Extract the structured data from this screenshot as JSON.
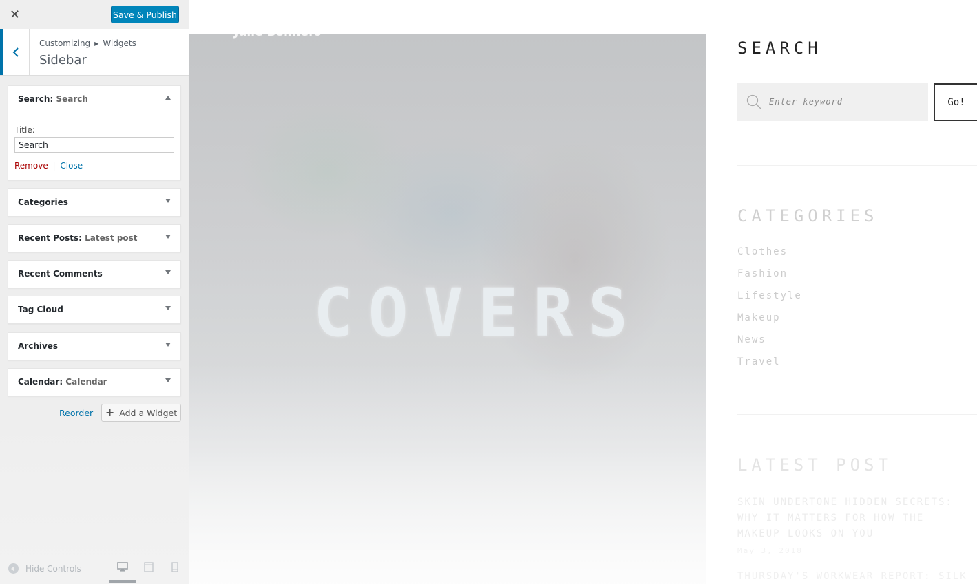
{
  "topbar": {
    "close_icon": "close-icon",
    "save_label": "Save & Publish"
  },
  "section": {
    "breadcrumb_parent": "Customizing",
    "breadcrumb_child": "Widgets",
    "title": "Sidebar"
  },
  "widgets": [
    {
      "type": "Search",
      "instance": "Search",
      "expanded": true
    },
    {
      "type": "Categories",
      "instance": ""
    },
    {
      "type": "Recent Posts",
      "instance": "Latest post"
    },
    {
      "type": "Recent Comments",
      "instance": ""
    },
    {
      "type": "Tag Cloud",
      "instance": ""
    },
    {
      "type": "Archives",
      "instance": ""
    },
    {
      "type": "Calendar",
      "instance": "Calendar"
    }
  ],
  "search_widget": {
    "title_label": "Title:",
    "title_value": "Search",
    "remove_label": "Remove",
    "separator": "|",
    "close_label": "Close"
  },
  "panel_actions": {
    "reorder_label": "Reorder",
    "add_widget_label": "Add a Widget"
  },
  "footer": {
    "hide_controls_label": "Hide Controls",
    "devices": [
      "desktop-icon",
      "tablet-icon",
      "mobile-icon"
    ],
    "active_device": "desktop"
  },
  "preview": {
    "hero_author": "Julie Bonnefo",
    "hero_word": "COVERS",
    "search_title": "SEARCH",
    "search_placeholder": "Enter keyword",
    "go_label": "Go!",
    "categories_title": "CATEGORIES",
    "categories": [
      "Clothes",
      "Fashion",
      "Lifestyle",
      "Makeup",
      "News",
      "Travel"
    ],
    "latest_title": "LATEST POST",
    "post1_title": "SKIN UNDERTONE HIDDEN SECRETS: WHY IT MATTERS FOR HOW THE MAKEUP LOOKS ON YOU",
    "post1_date": "May 3, 2018",
    "post2_title": "THURSDAY'S WORKWEAR REPORT: SILK BLEND"
  },
  "colors": {
    "accent": "#0085ba",
    "link": "#0073aa",
    "remove": "#aa0000"
  }
}
